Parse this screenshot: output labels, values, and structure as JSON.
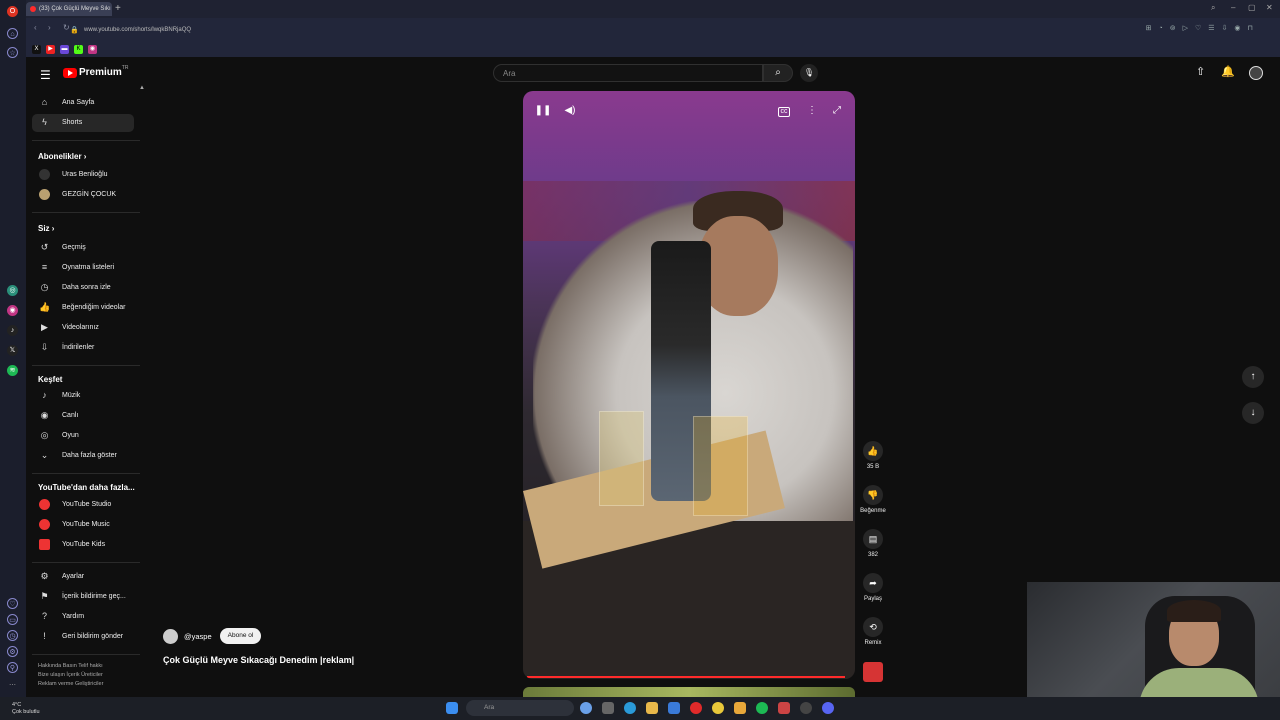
{
  "browser": {
    "tab_title": "(33) Çok Güçlü Meyve Sıkı",
    "url": "www.youtube.com/shorts/lwqkBNRjaQQ",
    "new_tab": "+"
  },
  "header": {
    "logo_text": "Premium",
    "logo_tm": "TR",
    "search_placeholder": "Ara"
  },
  "sidebar": {
    "home": "Ana Sayfa",
    "shorts": "Shorts",
    "subs_heading": "Abonelikler",
    "subs": [
      "Uras Benlioğlu",
      "GEZGİN ÇOCUK"
    ],
    "you_heading": "Siz",
    "you_items": [
      "Geçmiş",
      "Oynatma listeleri",
      "Daha sonra izle",
      "Beğendiğim videolar",
      "Videolarınız",
      "İndirilenler"
    ],
    "explore_heading": "Keşfet",
    "explore_items": [
      "Müzik",
      "Canlı",
      "Oyun",
      "Daha fazla göster"
    ],
    "more_heading": "YouTube'dan daha fazla...",
    "more_items": [
      "YouTube Studio",
      "YouTube Music",
      "YouTube Kids"
    ],
    "settings_items": [
      "Ayarlar",
      "İçerik bildirime geç...",
      "Yardım",
      "Geri bildirim gönder"
    ],
    "footer_lines": [
      "Hakkında  Basın  Telif hakkı",
      "Bize ulaşın  İçerik Üreticiler",
      "Reklam verme  Geliştiriciler"
    ]
  },
  "shorts": {
    "channel": "@yaspe",
    "subscribe": "Abone ol",
    "title": "Çok Güçlü Meyve Sıkacağı Denedim |reklam|",
    "likes": "35 B",
    "dislike_label": "Beğenme",
    "comments": "382",
    "share_label": "Paylaş",
    "remix_label": "Remix",
    "progress": 0.98
  },
  "taskbar": {
    "weather_temp": "4°C",
    "weather_desc": "Çok bulutlu",
    "search_placeholder": "Ara"
  },
  "colors": {
    "accent": "#ff0000",
    "background": "#0f0f0f"
  }
}
